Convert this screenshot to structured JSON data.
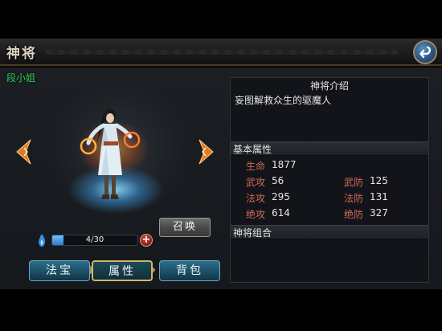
{
  "header": {
    "title": "神将",
    "back_icon": "return-arrow-icon"
  },
  "character": {
    "name": "段小姐"
  },
  "summon": {
    "label": "召唤"
  },
  "progress": {
    "current": 4,
    "max": 30,
    "text": "4/30"
  },
  "tabs": [
    {
      "label": "法宝",
      "active": false
    },
    {
      "label": "属性",
      "active": true
    },
    {
      "label": "背包",
      "active": false
    }
  ],
  "panel": {
    "intro_title": "神将介绍",
    "intro_text": "妄图解救众生的驱魔人",
    "base_title": "基本属性",
    "stats": {
      "hp": {
        "label": "生命",
        "value": "1877"
      },
      "wu_atk": {
        "label": "武攻",
        "value": "56"
      },
      "wu_def": {
        "label": "武防",
        "value": "125"
      },
      "fa_atk": {
        "label": "法攻",
        "value": "295"
      },
      "fa_def": {
        "label": "法防",
        "value": "131"
      },
      "jue_atk": {
        "label": "绝攻",
        "value": "614"
      },
      "jue_def": {
        "label": "绝防",
        "value": "327"
      }
    },
    "combo_title": "神将组合"
  },
  "colors": {
    "name_green": "#2fd45a",
    "stat_label_red": "#d06a58",
    "arrow_orange": "#e07a2a"
  }
}
